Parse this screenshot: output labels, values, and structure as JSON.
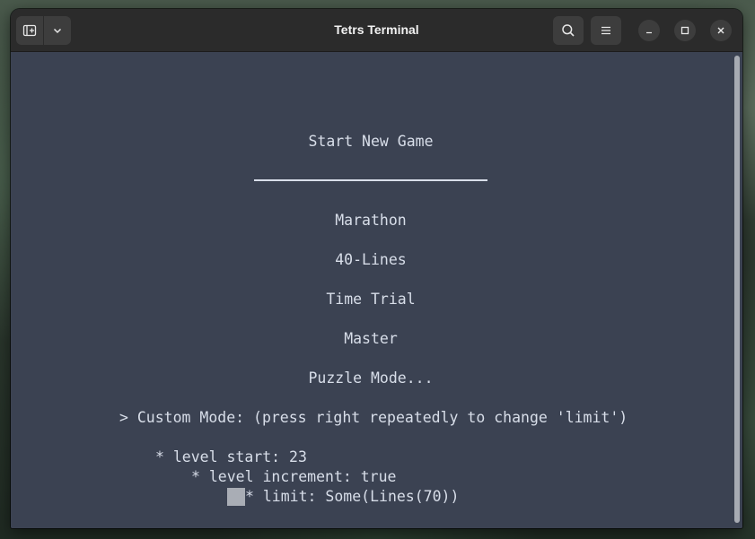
{
  "window": {
    "title": "Tetrs Terminal"
  },
  "toolbar": {
    "new_tab_icon": "new-tab-icon",
    "dropdown_icon": "chevron-down-icon",
    "search_icon": "search-icon",
    "menu_icon": "hamburger-menu-icon",
    "minimize_icon": "minimize-icon",
    "maximize_icon": "maximize-icon",
    "close_icon": "close-icon"
  },
  "menu": {
    "heading": "Start New Game",
    "items": [
      "Marathon",
      "40-Lines",
      "Time Trial",
      "Master",
      "Puzzle Mode..."
    ],
    "selected_item": "> Custom Mode: (press right repeatedly to change 'limit')",
    "settings": {
      "level_start": "* level start: 23",
      "level_increment": "* level increment: true",
      "limit": "* limit: Some(Lines(70))"
    }
  },
  "colors": {
    "terminal_bg": "#3b4252",
    "terminal_fg": "#d8dee9",
    "titlebar_bg": "#2b2b2b"
  }
}
